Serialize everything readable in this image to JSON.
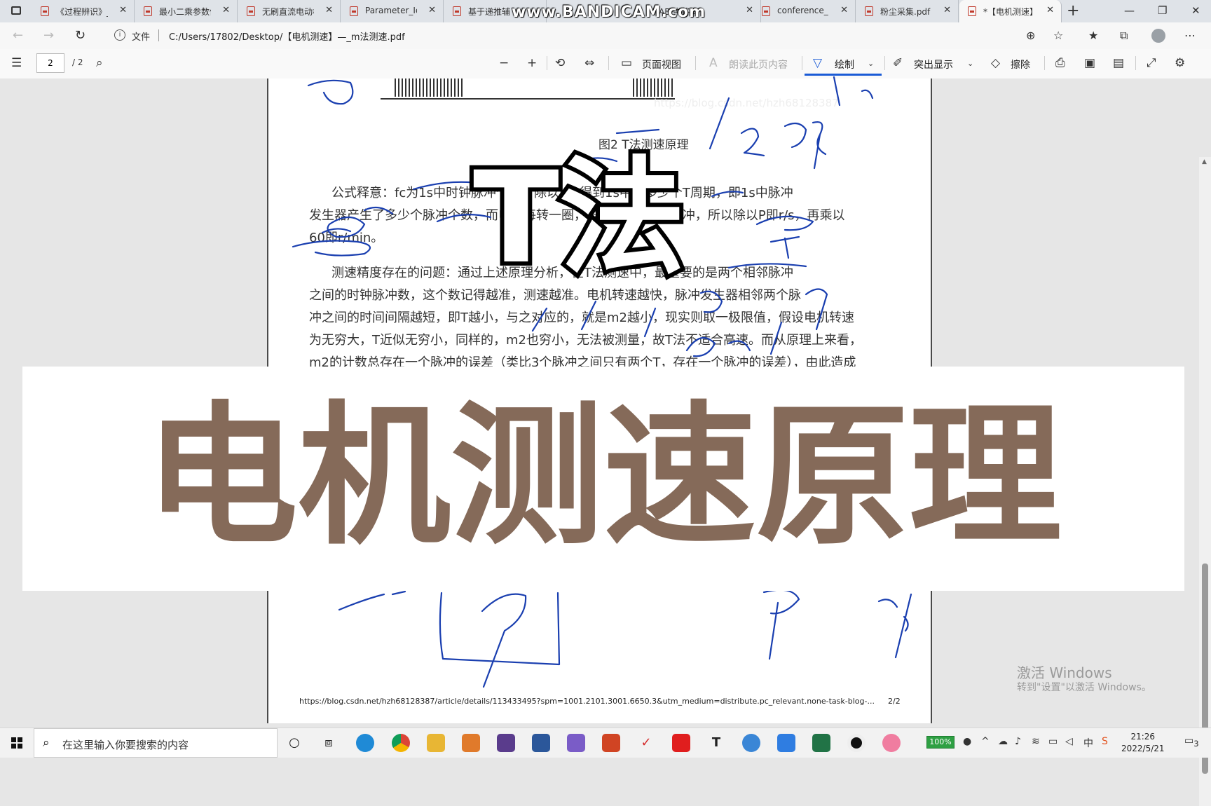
{
  "browser": {
    "tabs": [
      {
        "title": "《过程辨识》_",
        "active": false
      },
      {
        "title": "最小二乘参数估",
        "active": false
      },
      {
        "title": "无刷直流电动机",
        "active": false
      },
      {
        "title": "Parameter_Ide",
        "active": false
      },
      {
        "title": "基于递推辅",
        "active": false
      },
      {
        "title": "AB 中将伺",
        "active": false
      },
      {
        "title": "conference_10",
        "active": false
      },
      {
        "title": "粉尘采集.pdf",
        "active": false
      },
      {
        "title": "*【电机测速】",
        "active": true
      }
    ],
    "recorder_watermark": "www.BANDICAM.com",
    "address": {
      "scheme_label": "文件",
      "url": "C:/Users/17802/Desktop/【电机测速】—_m法测速.pdf"
    }
  },
  "pdf_toolbar": {
    "page_current": "2",
    "page_total": "/ 2",
    "page_view_label": "页面视图",
    "read_aloud_label": "朗读此页内容",
    "draw_label": "绘制",
    "highlight_label": "突出显示",
    "erase_label": "擦除"
  },
  "document": {
    "faint_watermark": "https://blog.csdn.net/hzh68128387",
    "caption": "图2 T法测速原理",
    "para1_lines": [
      "公式释意：fc为1s中时钟脉冲个数，除以m2得到1s中有多少个T周期，即1s中脉冲",
      "发生器产生了多少个脉冲个数，而电机每转一圈，发生器产生P个脉冲，所以除以P即r/s，再乘以",
      "60即r/min。"
    ],
    "para2_lines": [
      "测速精度存在的问题：通过上述原理分析，在T法测速中，最重要的是两个相邻脉冲",
      "之间的时钟脉冲数，这个数记得越准，测速越准。电机转速越快，脉冲发生器相邻两个脉",
      "冲之间的时间间隔越短，即T越小，与之对应的，就是m2越小，现实则取一极限值，假设电机转速",
      "为无穷大，T近似无穷小，同样的，m2也穷小，无法被测量，故T法不适合高速。而从原理上来看，",
      "m2的计数总存在一个脉冲的误差（类比3个脉冲之间只有两个T，存在一个脉冲的误差），由此造成"
    ],
    "footer_url": "https://blog.csdn.net/hzh68128387/article/details/113433495?spm=1001.2101.3001.6650.3&utm_medium=distribute.pc_relevant.none-task-blog-...",
    "footer_page": "2/2"
  },
  "overlay": {
    "big_letter": "T法",
    "banner_text": "电机测速原理",
    "banner_color": "#856a59",
    "ink_color": "#1a3fb0"
  },
  "windows_activation": {
    "title": "激活 Windows",
    "subtitle": "转到\"设置\"以激活 Windows。"
  },
  "taskbar": {
    "search_placeholder": "在这里输入你要搜索的内容",
    "battery": "100%",
    "ime_label": "中",
    "time": "21:26",
    "date": "2022/5/21",
    "notification_count": "3"
  }
}
